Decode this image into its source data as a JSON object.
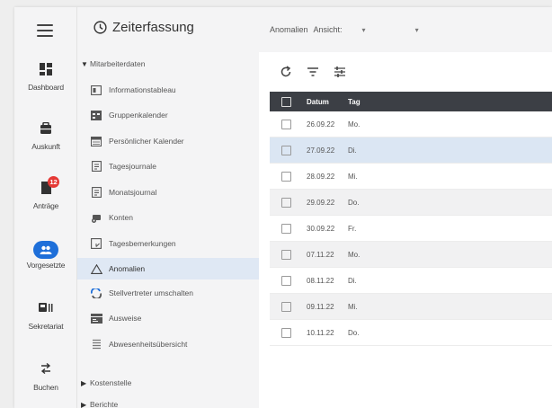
{
  "rail": {
    "items": [
      {
        "label": "Dashboard",
        "icon": "dashboard-icon"
      },
      {
        "label": "Auskunft",
        "icon": "briefcase-icon"
      },
      {
        "label": "Anträge",
        "icon": "document-icon",
        "badge": "12"
      },
      {
        "label": "Vorgesetzte",
        "icon": "people-icon"
      },
      {
        "label": "Sekretariat",
        "icon": "secretary-icon"
      },
      {
        "label": "Buchen",
        "icon": "swap-icon"
      }
    ],
    "accent": "#1e6fd9",
    "badge_color": "#e53935"
  },
  "nav": {
    "title": "Zeiterfassung",
    "section": "Mitarbeiterdaten",
    "items": [
      {
        "label": "Informationstableau",
        "icon": "tableau-icon"
      },
      {
        "label": "Gruppenkalender",
        "icon": "group-calendar-icon"
      },
      {
        "label": "Persönlicher Kalender",
        "icon": "calendar-icon"
      },
      {
        "label": "Tagesjournale",
        "icon": "journal-icon"
      },
      {
        "label": "Monatsjournal",
        "icon": "journal-icon"
      },
      {
        "label": "Konten",
        "icon": "accounts-icon"
      },
      {
        "label": "Tagesbemerkungen",
        "icon": "comment-icon"
      },
      {
        "label": "Anomalien",
        "icon": "warning-icon"
      },
      {
        "label": "Stellvertreter umschalten",
        "icon": "substitute-icon"
      },
      {
        "label": "Ausweise",
        "icon": "id-card-icon"
      },
      {
        "label": "Abwesenheitsübersicht",
        "icon": "absence-icon"
      }
    ],
    "collapsed": [
      "Kostenstelle",
      "Berichte"
    ]
  },
  "topbar": {
    "title": "Anomalien",
    "view_label": "Ansicht:",
    "dropdown_1": "▾",
    "dropdown_2": "▾"
  },
  "table": {
    "headers": {
      "date": "Datum",
      "day": "Tag"
    },
    "header_bg": "#3c3f45",
    "rows": [
      {
        "date": "26.09.22",
        "day": "Mo."
      },
      {
        "date": "27.09.22",
        "day": "Di."
      },
      {
        "date": "28.09.22",
        "day": "Mi."
      },
      {
        "date": "29.09.22",
        "day": "Do."
      },
      {
        "date": "30.09.22",
        "day": "Fr."
      },
      {
        "date": "07.11.22",
        "day": "Mo."
      },
      {
        "date": "08.11.22",
        "day": "Di."
      },
      {
        "date": "09.11.22",
        "day": "Mi."
      },
      {
        "date": "10.11.22",
        "day": "Do."
      }
    ]
  }
}
